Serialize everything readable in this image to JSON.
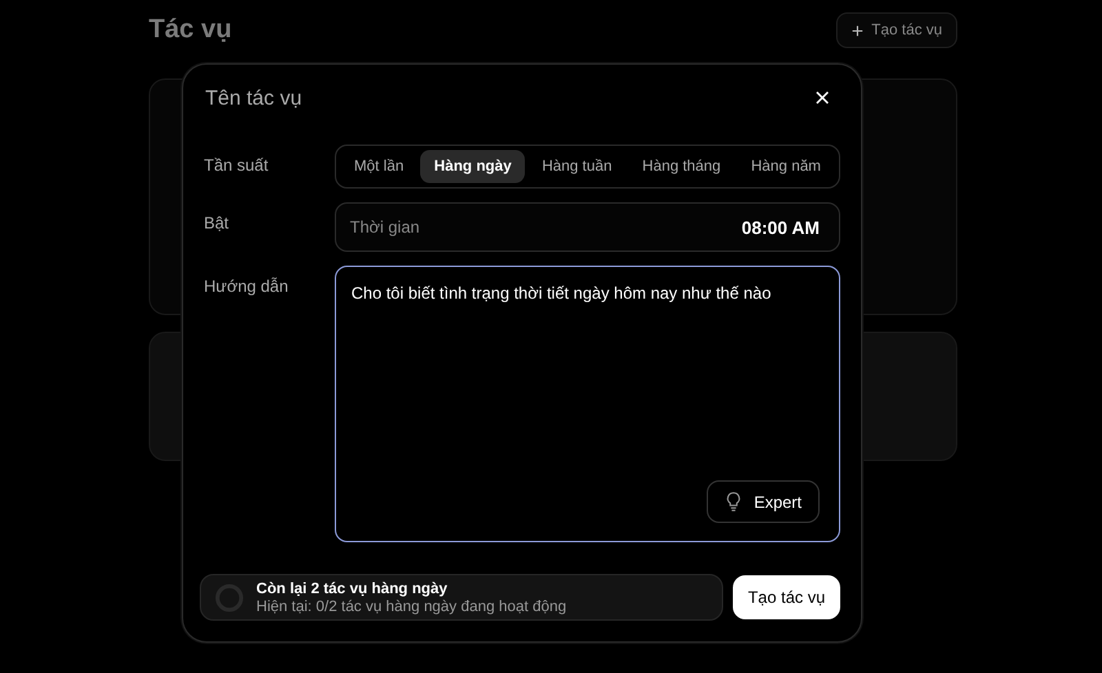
{
  "page": {
    "title": "Tác vụ",
    "create_button": "Tạo tác vụ"
  },
  "dialog": {
    "name_field": {
      "placeholder": "Tên tác vụ"
    },
    "frequency": {
      "label": "Tần suất",
      "options": [
        {
          "label": "Một lần",
          "selected": false
        },
        {
          "label": "Hàng ngày",
          "selected": true
        },
        {
          "label": "Hàng tuần",
          "selected": false
        },
        {
          "label": "Hàng tháng",
          "selected": false
        },
        {
          "label": "Hàng năm",
          "selected": false
        }
      ]
    },
    "schedule": {
      "label": "Bật",
      "field_label": "Thời gian",
      "value": "08:00 AM"
    },
    "instructions": {
      "label": "Hướng dẫn",
      "value": "Cho tôi biết tình trạng thời tiết ngày hôm nay như thế nào",
      "focused": true,
      "mode_button": "Expert"
    },
    "quota": {
      "title": "Còn lại 2 tác vụ hàng ngày",
      "detail": "Hiện tại: 0/2 tác vụ hàng ngày đang hoạt động"
    },
    "submit_button": "Tạo tác vụ"
  }
}
